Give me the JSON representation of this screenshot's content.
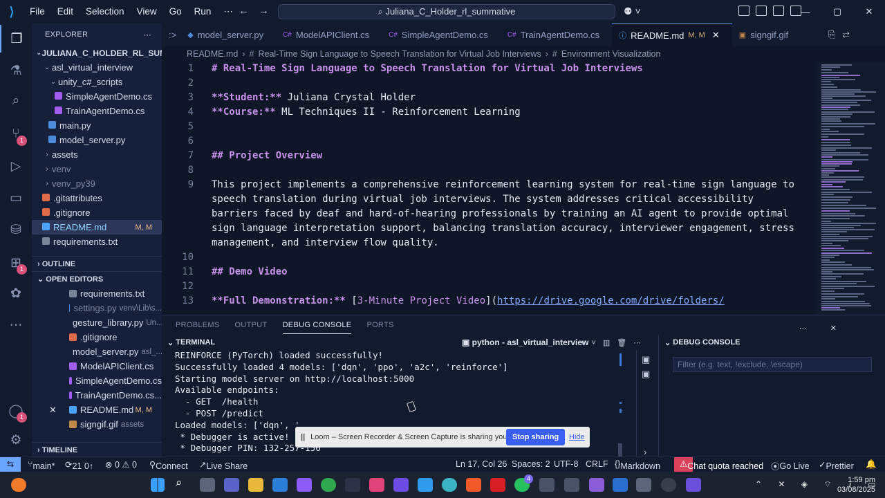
{
  "titlebar": {
    "menu": [
      "File",
      "Edit",
      "Selection",
      "View",
      "Go",
      "Run",
      "⋯"
    ],
    "command_center": "Juliana_C_Holder_rl_summative",
    "window_controls": [
      "—",
      "▢",
      "✕"
    ]
  },
  "activity": {
    "icons": [
      "explorer-icon",
      "flask-icon",
      "search-icon",
      "source-control-icon",
      "run-debug-icon",
      "remote-explorer-icon",
      "database-icon",
      "extensions-icon",
      "github-icon",
      "more-icon",
      "account-icon",
      "settings-icon"
    ],
    "badges": {
      "source_control": "1",
      "extensions": "1",
      "account": "1"
    }
  },
  "sidebar": {
    "header": "EXPLORER",
    "root": "JULIANA_C_HOLDER_RL_SUMM...",
    "tree": [
      {
        "label": "asl_virtual_interview",
        "indent": 1,
        "kind": "folder-open"
      },
      {
        "label": "unity_c#_scripts",
        "indent": 2,
        "kind": "folder-open"
      },
      {
        "label": "SimpleAgentDemo.cs",
        "indent": 3,
        "kind": "cs"
      },
      {
        "label": "TrainAgentDemo.cs",
        "indent": 3,
        "kind": "cs"
      },
      {
        "label": "main.py",
        "indent": 2,
        "kind": "py"
      },
      {
        "label": "model_server.py",
        "indent": 2,
        "kind": "py"
      },
      {
        "label": "assets",
        "indent": 1,
        "kind": "folder"
      },
      {
        "label": "venv",
        "indent": 1,
        "kind": "folder-dim"
      },
      {
        "label": "venv_py39",
        "indent": 1,
        "kind": "folder-dim"
      },
      {
        "label": ".gitattributes",
        "indent": 1,
        "kind": "git"
      },
      {
        "label": ".gitignore",
        "indent": 1,
        "kind": "git"
      },
      {
        "label": "README.md",
        "indent": 1,
        "kind": "md",
        "mod": "M, M",
        "selected": true
      },
      {
        "label": "requirements.txt",
        "indent": 1,
        "kind": "txt"
      }
    ],
    "outline_label": "OUTLINE",
    "open_editors_label": "OPEN EDITORS",
    "open_editors": [
      {
        "label": "requirements.txt",
        "path": "",
        "kind": "txt"
      },
      {
        "label": "settings.py",
        "path": "venv\\Lib\\s...",
        "kind": "py",
        "dim": true
      },
      {
        "label": "gesture_library.py",
        "path": "Un...",
        "kind": "py"
      },
      {
        "label": ".gitignore",
        "path": "",
        "kind": "git"
      },
      {
        "label": "model_server.py",
        "path": "asl_...",
        "kind": "py"
      },
      {
        "label": "ModelAPIClient.cs",
        "path": "",
        "kind": "cs"
      },
      {
        "label": "SimpleAgentDemo.cs",
        "path": "",
        "kind": "cs"
      },
      {
        "label": "TrainAgentDemo.cs...",
        "path": "",
        "kind": "cs"
      },
      {
        "label": "README.md",
        "path": "",
        "kind": "md",
        "mod": "M, M",
        "close": true
      },
      {
        "label": "signgif.gif",
        "path": "assets",
        "kind": "gif"
      }
    ],
    "timeline_label": "TIMELINE"
  },
  "tabs": [
    {
      "label": "model_server.py",
      "icon": "py"
    },
    {
      "label": "ModelAPIClient.cs",
      "icon": "cs"
    },
    {
      "label": "SimpleAgentDemo.cs",
      "icon": "cs"
    },
    {
      "label": "TrainAgentDemo.cs",
      "icon": "cs"
    },
    {
      "label": "README.md",
      "icon": "md",
      "mod": "M, M",
      "active": true
    },
    {
      "label": "signgif.gif",
      "icon": "gif"
    }
  ],
  "breadcrumb": [
    "README.md",
    "#",
    "Real-Time Sign Language to Speech Translation for Virtual Job Interviews",
    "#",
    "Environment Visualization"
  ],
  "editor": {
    "lines": [
      {
        "n": "1",
        "segs": [
          [
            "h",
            "# Real-Time Sign Language to Speech Translation for Virtual Job Interviews"
          ]
        ]
      },
      {
        "n": "2",
        "segs": []
      },
      {
        "n": "3",
        "segs": [
          [
            "b",
            "**Student:**"
          ],
          [
            "t",
            " Juliana Crystal Holder"
          ]
        ]
      },
      {
        "n": "4",
        "segs": [
          [
            "b",
            "**Course:**"
          ],
          [
            "t",
            " ML Techniques II - Reinforcement Learning"
          ]
        ]
      },
      {
        "n": "5",
        "segs": []
      },
      {
        "n": "6",
        "segs": []
      },
      {
        "n": "7",
        "segs": [
          [
            "h",
            "## Project Overview"
          ]
        ]
      },
      {
        "n": "8",
        "segs": []
      },
      {
        "n": "9",
        "segs": [
          [
            "t",
            "This project implements a comprehensive reinforcement learning system for real-time sign language to"
          ]
        ]
      },
      {
        "n": "",
        "segs": [
          [
            "t",
            "speech translation during virtual job interviews. The system addresses critical accessibility"
          ]
        ]
      },
      {
        "n": "",
        "segs": [
          [
            "t",
            "barriers faced by deaf and hard-of-hearing professionals by training an AI agent to provide optimal"
          ]
        ]
      },
      {
        "n": "",
        "segs": [
          [
            "t",
            "sign language interpretation support, balancing translation accuracy, interviewer engagement, stress"
          ]
        ]
      },
      {
        "n": "",
        "segs": [
          [
            "t",
            "management, and interview flow quality."
          ]
        ]
      },
      {
        "n": "10",
        "segs": []
      },
      {
        "n": "11",
        "segs": [
          [
            "h",
            "## Demo Video"
          ]
        ]
      },
      {
        "n": "12",
        "segs": []
      },
      {
        "n": "13",
        "segs": [
          [
            "b",
            "**Full Demonstration:**"
          ],
          [
            "t",
            " ["
          ],
          [
            "lnk",
            "3-Minute Project Video"
          ],
          [
            "t",
            "]("
          ],
          [
            "url",
            "https://drive.google.com/drive/folders/"
          ]
        ]
      }
    ]
  },
  "panel": {
    "tabs": [
      "PROBLEMS",
      "OUTPUT",
      "DEBUG CONSOLE",
      "PORTS"
    ],
    "active_tab": "DEBUG CONSOLE",
    "terminal_label": "TERMINAL",
    "shell": "python - asl_virtual_interview",
    "terminal_lines": [
      "REINFORCE (PyTorch) loaded successfully!",
      "Successfully loaded 4 models: ['dqn', 'ppo', 'a2c', 'reinforce']",
      "Starting model server on http://localhost:5000",
      "Available endpoints:",
      "  - GET  /health",
      "  - POST /predict",
      "Loaded models: ['dqn', '",
      " * Debugger is active!",
      " * Debugger PIN: 132-257-156"
    ],
    "debug_console_label": "DEBUG CONSOLE",
    "filter_placeholder": "Filter (e.g. text, !exclude, \\escape)"
  },
  "loom": {
    "message": "Loom – Screen Recorder & Screen Capture is sharing your screen.",
    "stop": "Stop sharing",
    "hide": "Hide"
  },
  "status": {
    "branch": "main*",
    "sync": "21 0↑",
    "problems": "⊗ 0  ⚠ 0",
    "connect": "Connect",
    "live_share": "Live Share",
    "cursor": "Ln 17, Col 26",
    "spaces": "Spaces: 2",
    "encoding": "UTF-8",
    "eol": "CRLF",
    "language": "Markdown",
    "quota": "Chat quota reached",
    "go_live": "Go Live",
    "prettier": "Prettier"
  },
  "taskbar": {
    "time": "1:59 pm",
    "date": "03/08/2025",
    "whatsapp_badge": "4"
  },
  "colors": {
    "accent": "#6aa6ff",
    "markdown_heading": "#c792ea",
    "link": "#82aaff",
    "badge": "#d9507a",
    "quota": "#d9425a",
    "loom_button": "#3a5ff0"
  }
}
